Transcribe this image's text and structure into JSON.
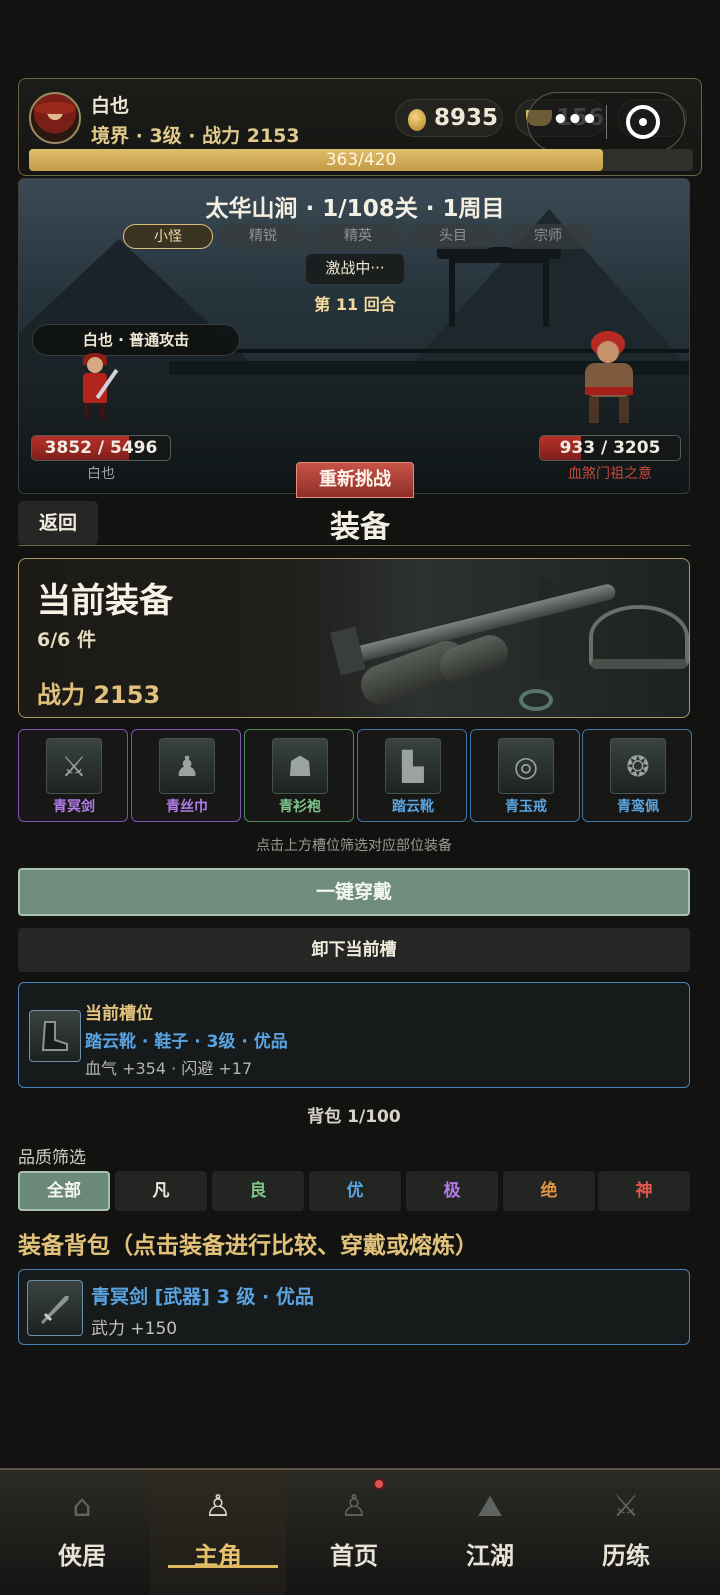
{
  "player": {
    "name": "白也",
    "stats_line": "境界 · 3级 · 战力 2153",
    "gold": "8935",
    "ingots": "156",
    "exp_text": "363/420",
    "exp_fraction": 0.864
  },
  "capsule": {
    "more": "•••"
  },
  "battle": {
    "stage_title": "太华山涧 · 1/108关 · 1周目",
    "difficulty_tabs": [
      "小怪",
      "精锐",
      "精英",
      "头目",
      "宗师"
    ],
    "active_tab": 0,
    "status": "激战中···",
    "round": "第 11 回合",
    "action": "白也 · 普通攻击",
    "hero_hp_text": "3852 / 5496",
    "hero_hp_fraction": 0.7,
    "hero_name": "白也",
    "enemy_hp_text": "933 / 3205",
    "enemy_hp_fraction": 0.29,
    "enemy_name": "血煞门祖之意",
    "rechallenge": "重新挑战"
  },
  "equip_page": {
    "back": "返回",
    "title": "装备",
    "current_title": "当前装备",
    "current_count": "6/6 件",
    "current_power": "战力 2153",
    "slots": [
      {
        "name": "青冥剑",
        "color": "#b17be8",
        "border": "#7c52b4",
        "icon": "⚔"
      },
      {
        "name": "青丝巾",
        "color": "#b17be8",
        "border": "#7c52b4",
        "icon": "♟"
      },
      {
        "name": "青衫袍",
        "color": "#7fc48a",
        "border": "#4f8a58",
        "icon": "☗"
      },
      {
        "name": "踏云靴",
        "color": "#5aa3df",
        "border": "#3f73a3",
        "icon": "▙"
      },
      {
        "name": "青玉戒",
        "color": "#5aa3df",
        "border": "#3f73a3",
        "icon": "◎"
      },
      {
        "name": "青鸾佩",
        "color": "#5aa3df",
        "border": "#3f73a3",
        "icon": "❂"
      }
    ],
    "hint": "点击上方槽位筛选对应部位装备",
    "equip_all": "一键穿戴",
    "unequip": "卸下当前槽",
    "slot_detail": {
      "head": "当前槽位",
      "item": "踏云靴 · 鞋子 · 3级 · 优品",
      "stats": "血气 +354 · 闪避 +17"
    },
    "bag_count": "背包 1/100",
    "filter_label": "品质筛选",
    "qualities": [
      {
        "label": "全部",
        "color": "#f4f6f2"
      },
      {
        "label": "凡",
        "color": "#e9e6de"
      },
      {
        "label": "良",
        "color": "#7fc48a"
      },
      {
        "label": "优",
        "color": "#5aa3df"
      },
      {
        "label": "极",
        "color": "#b17be8"
      },
      {
        "label": "绝",
        "color": "#e0913f"
      },
      {
        "label": "神",
        "color": "#e0584d"
      }
    ],
    "bag_title": "装备背包（点击装备进行比较、穿戴或熔炼）",
    "bag_items": [
      {
        "name": "青冥剑 [武器] 3 级 · 优品",
        "stat": "武力 +150"
      }
    ]
  },
  "nav": [
    {
      "label": "侠居",
      "icon": "house-icon",
      "glyph": "⌂"
    },
    {
      "label": "主角",
      "icon": "hero-icon",
      "glyph": "♙"
    },
    {
      "label": "首页",
      "icon": "home-icon",
      "glyph": "♙"
    },
    {
      "label": "江湖",
      "icon": "mountain-icon",
      "glyph": "⛰"
    },
    {
      "label": "历练",
      "icon": "crossed-swords-icon",
      "glyph": "⚔"
    }
  ],
  "nav_active": 1
}
